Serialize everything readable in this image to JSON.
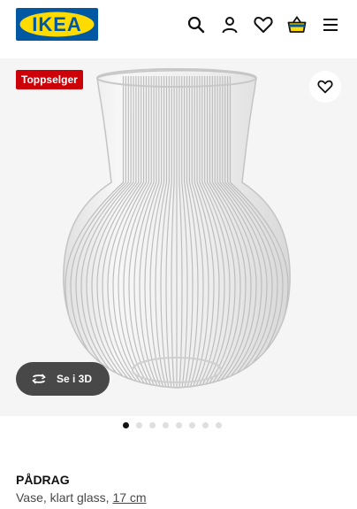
{
  "header": {
    "logo_text": "IKEA",
    "icons": [
      "search-icon",
      "user-icon",
      "heart-icon",
      "basket-icon",
      "menu-icon"
    ]
  },
  "gallery": {
    "badge": "Toppselger",
    "view_3d_label": "Se i 3D",
    "slide_count": 8,
    "active_slide": 1
  },
  "product": {
    "name": "PÅDRAG",
    "description": "Vase, klart glass,",
    "measure": "17 cm"
  },
  "colors": {
    "logo_blue": "#0058a3",
    "logo_yellow": "#ffdb00",
    "badge_red": "#cc0008",
    "button_dark": "#484848"
  }
}
